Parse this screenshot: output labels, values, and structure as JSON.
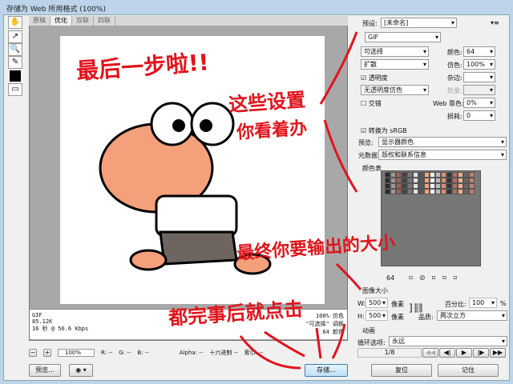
{
  "title": "存储为 Web 所用格式 (100%)",
  "tabs": [
    "原稿",
    "优化",
    "双联",
    "四联"
  ],
  "info": {
    "format": "GIF",
    "size": "85.12K",
    "time": "16 秒 @ 56.6 Kbps",
    "dither": "100% 仿色",
    "palette": "\"可选择\" 调板",
    "colors": "64 颜色"
  },
  "bottom": {
    "zoom": "100%",
    "r": "R: --",
    "g": "G: --",
    "b": "B: --",
    "alpha": "Alpha: --",
    "hex": "十六进制 --",
    "index": "索引: --"
  },
  "buttons": {
    "preview": "预览...",
    "save": "存储...",
    "reset": "复位",
    "remember": "记住"
  },
  "panel": {
    "preset_label": "预设:",
    "preset": "[未命名]",
    "format": "GIF",
    "reduction": "可选择",
    "colors_label": "颜色:",
    "colors": "64",
    "dither_algo": "扩散",
    "dither_label": "仿色:",
    "dither": "100%",
    "transparency": "透明度",
    "matte_label": "杂边:",
    "trans_dither": "无透明度仿色",
    "amount_label": "数量:",
    "interlaced": "交错",
    "websnap_label": "Web 靠色:",
    "websnap": "0%",
    "lossy_label": "损耗:",
    "lossy": "0",
    "srgb": "转换为 sRGB",
    "preview_label": "预览:",
    "preview": "显示器颜色",
    "metadata_label": "元数据:",
    "metadata": "版权和联系信息",
    "color_table": "颜色表",
    "table_count": "64",
    "image_size": "图像大小",
    "w_label": "W:",
    "w": "500",
    "h_label": "H:",
    "h": "500",
    "unit": "像素",
    "percent_label": "百分比:",
    "percent": "100",
    "pct": "%",
    "quality_label": "品质:",
    "quality": "两次立方",
    "animation": "动画",
    "loop_label": "循环选项:",
    "loop": "永远",
    "frame": "1/8"
  },
  "annotations": [
    "最后一步啦!!",
    "这些设置",
    "你看着办",
    "最终你要输出的大小",
    "都完事后就点击"
  ]
}
